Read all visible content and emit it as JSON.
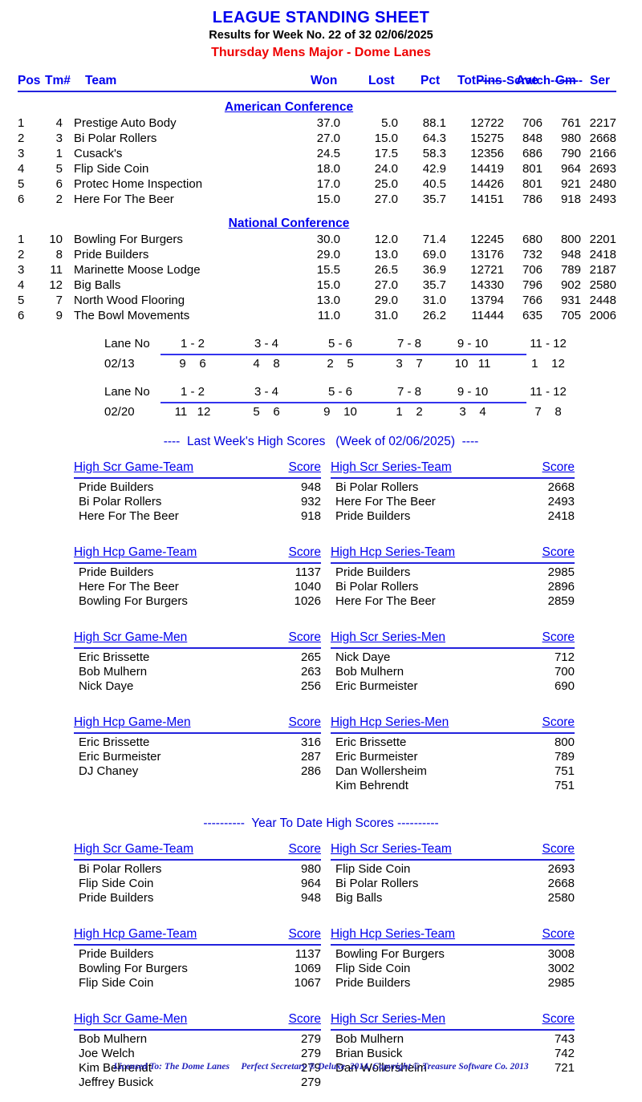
{
  "header": {
    "title": "LEAGUE STANDING SHEET",
    "subtitle": "Results for Week No. 22 of 32    02/06/2025",
    "league": "Thursday Mens Major - Dome Lanes",
    "title_color": "#0000ee",
    "league_color": "#ee0000"
  },
  "standings": {
    "scratch_group_label": "-------Scratch--------",
    "columns": {
      "pos": "Pos",
      "tm": "Tm#",
      "team": "Team",
      "won": "Won",
      "lost": "Lost",
      "pct": "Pct",
      "totpins": "TotPins",
      "ave": "Ave",
      "gm": "Gm",
      "ser": "Ser"
    },
    "conferences": [
      {
        "name": "American Conference",
        "rows": [
          {
            "pos": "1",
            "tm": "4",
            "team": "Prestige Auto Body",
            "won": "37.0",
            "lost": "5.0",
            "pct": "88.1",
            "totpins": "12722",
            "ave": "706",
            "gm": "761",
            "ser": "2217"
          },
          {
            "pos": "2",
            "tm": "3",
            "team": "Bi Polar Rollers",
            "won": "27.0",
            "lost": "15.0",
            "pct": "64.3",
            "totpins": "15275",
            "ave": "848",
            "gm": "980",
            "ser": "2668"
          },
          {
            "pos": "3",
            "tm": "1",
            "team": "Cusack's",
            "won": "24.5",
            "lost": "17.5",
            "pct": "58.3",
            "totpins": "12356",
            "ave": "686",
            "gm": "790",
            "ser": "2166"
          },
          {
            "pos": "4",
            "tm": "5",
            "team": "Flip Side Coin",
            "won": "18.0",
            "lost": "24.0",
            "pct": "42.9",
            "totpins": "14419",
            "ave": "801",
            "gm": "964",
            "ser": "2693"
          },
          {
            "pos": "5",
            "tm": "6",
            "team": "Protec Home Inspection",
            "won": "17.0",
            "lost": "25.0",
            "pct": "40.5",
            "totpins": "14426",
            "ave": "801",
            "gm": "921",
            "ser": "2480"
          },
          {
            "pos": "6",
            "tm": "2",
            "team": "Here For The Beer",
            "won": "15.0",
            "lost": "27.0",
            "pct": "35.7",
            "totpins": "14151",
            "ave": "786",
            "gm": "918",
            "ser": "2493"
          }
        ]
      },
      {
        "name": "National Conference",
        "rows": [
          {
            "pos": "1",
            "tm": "10",
            "team": "Bowling For Burgers",
            "won": "30.0",
            "lost": "12.0",
            "pct": "71.4",
            "totpins": "12245",
            "ave": "680",
            "gm": "800",
            "ser": "2201"
          },
          {
            "pos": "2",
            "tm": "8",
            "team": "Pride Builders",
            "won": "29.0",
            "lost": "13.0",
            "pct": "69.0",
            "totpins": "13176",
            "ave": "732",
            "gm": "948",
            "ser": "2418"
          },
          {
            "pos": "3",
            "tm": "11",
            "team": "Marinette Moose Lodge",
            "won": "15.5",
            "lost": "26.5",
            "pct": "36.9",
            "totpins": "12721",
            "ave": "706",
            "gm": "789",
            "ser": "2187"
          },
          {
            "pos": "4",
            "tm": "12",
            "team": "Big Balls",
            "won": "15.0",
            "lost": "27.0",
            "pct": "35.7",
            "totpins": "14330",
            "ave": "796",
            "gm": "902",
            "ser": "2580"
          },
          {
            "pos": "5",
            "tm": "7",
            "team": "North Wood Flooring",
            "won": "13.0",
            "lost": "29.0",
            "pct": "31.0",
            "totpins": "13794",
            "ave": "766",
            "gm": "931",
            "ser": "2448"
          },
          {
            "pos": "6",
            "tm": "9",
            "team": "The Bowl Movements",
            "won": "11.0",
            "lost": "31.0",
            "pct": "26.2",
            "totpins": "11444",
            "ave": "635",
            "gm": "705",
            "ser": "2006"
          }
        ]
      }
    ]
  },
  "lane_schedules": [
    {
      "label": "Lane No",
      "date": "02/13",
      "lane_pairs": [
        "1 - 2",
        "3 - 4",
        "5 - 6",
        "7 - 8",
        "9 - 10",
        "11 - 12"
      ],
      "matchups": [
        "9    6",
        "4    8",
        "2    5",
        "3    7",
        "10   11",
        "1    12"
      ]
    },
    {
      "label": "Lane No",
      "date": "02/20",
      "lane_pairs": [
        "1 - 2",
        "3 - 4",
        "5 - 6",
        "7 - 8",
        "9 - 10",
        "11 - 12"
      ],
      "matchups": [
        "11   12",
        "5    6",
        "9    10",
        "1    2",
        "3    4",
        "7    8"
      ]
    }
  ],
  "last_week": {
    "section_title": "----  Last Week's High Scores   (Week of 02/06/2025)  ----",
    "score_header": "Score",
    "groups": [
      {
        "left": {
          "title": "High Scr Game-Team",
          "rows": [
            {
              "name": "Pride Builders",
              "score": "948"
            },
            {
              "name": "Bi Polar Rollers",
              "score": "932"
            },
            {
              "name": "Here For The Beer",
              "score": "918"
            }
          ]
        },
        "right": {
          "title": "High Scr Series-Team",
          "rows": [
            {
              "name": "Bi Polar Rollers",
              "score": "2668"
            },
            {
              "name": "Here For The Beer",
              "score": "2493"
            },
            {
              "name": "Pride Builders",
              "score": "2418"
            }
          ]
        }
      },
      {
        "left": {
          "title": "High Hcp Game-Team",
          "rows": [
            {
              "name": "Pride Builders",
              "score": "1137"
            },
            {
              "name": "Here For The Beer",
              "score": "1040"
            },
            {
              "name": "Bowling For Burgers",
              "score": "1026"
            }
          ]
        },
        "right": {
          "title": "High Hcp Series-Team",
          "rows": [
            {
              "name": "Pride Builders",
              "score": "2985"
            },
            {
              "name": "Bi Polar Rollers",
              "score": "2896"
            },
            {
              "name": "Here For The Beer",
              "score": "2859"
            }
          ]
        }
      },
      {
        "left": {
          "title": "High Scr Game-Men",
          "rows": [
            {
              "name": "Eric Brissette",
              "score": "265"
            },
            {
              "name": "Bob Mulhern",
              "score": "263"
            },
            {
              "name": "Nick Daye",
              "score": "256"
            }
          ]
        },
        "right": {
          "title": "High Scr Series-Men",
          "rows": [
            {
              "name": "Nick Daye",
              "score": "712"
            },
            {
              "name": "Bob Mulhern",
              "score": "700"
            },
            {
              "name": "Eric Burmeister",
              "score": "690"
            }
          ]
        }
      },
      {
        "left": {
          "title": "High Hcp Game-Men",
          "rows": [
            {
              "name": "Eric Brissette",
              "score": "316"
            },
            {
              "name": "Eric Burmeister",
              "score": "287"
            },
            {
              "name": "DJ Chaney",
              "score": "286"
            }
          ]
        },
        "right": {
          "title": "High Hcp Series-Men",
          "rows": [
            {
              "name": "Eric Brissette",
              "score": "800"
            },
            {
              "name": "Eric Burmeister",
              "score": "789"
            },
            {
              "name": "Dan Wollersheim",
              "score": "751"
            },
            {
              "name": "Kim Behrendt",
              "score": "751"
            }
          ]
        }
      }
    ]
  },
  "year_to_date": {
    "section_title": "----------  Year To Date High Scores ----------",
    "score_header": "Score",
    "groups": [
      {
        "left": {
          "title": "High Scr Game-Team",
          "rows": [
            {
              "name": "Bi Polar Rollers",
              "score": "980"
            },
            {
              "name": "Flip Side Coin",
              "score": "964"
            },
            {
              "name": "Pride Builders",
              "score": "948"
            }
          ]
        },
        "right": {
          "title": "High Scr Series-Team",
          "rows": [
            {
              "name": "Flip Side Coin",
              "score": "2693"
            },
            {
              "name": "Bi Polar Rollers",
              "score": "2668"
            },
            {
              "name": "Big Balls",
              "score": "2580"
            }
          ]
        }
      },
      {
        "left": {
          "title": "High Hcp Game-Team",
          "rows": [
            {
              "name": "Pride Builders",
              "score": "1137"
            },
            {
              "name": "Bowling For Burgers",
              "score": "1069"
            },
            {
              "name": "Flip Side Coin",
              "score": "1067"
            }
          ]
        },
        "right": {
          "title": "High Hcp Series-Team",
          "rows": [
            {
              "name": "Bowling For Burgers",
              "score": "3008"
            },
            {
              "name": "Flip Side Coin",
              "score": "3002"
            },
            {
              "name": "Pride Builders",
              "score": "2985"
            }
          ]
        }
      },
      {
        "left": {
          "title": "High Scr Game-Men",
          "rows": [
            {
              "name": "Bob Mulhern",
              "score": "279"
            },
            {
              "name": "Joe Welch",
              "score": "279"
            },
            {
              "name": "Kim Behrendt",
              "score": "279"
            },
            {
              "name": "Jeffrey Busick",
              "score": "279"
            }
          ]
        },
        "right": {
          "title": "High Scr Series-Men",
          "rows": [
            {
              "name": "Bob Mulhern",
              "score": "743"
            },
            {
              "name": "Brian Busick",
              "score": "742"
            },
            {
              "name": "Dan Wollersheim",
              "score": "721"
            }
          ]
        }
      }
    ]
  },
  "footer": {
    "text": "Licensed To: The Dome Lanes     Perfect Secretary ® Deluxe  2014, Copyright © Treasure Software Co. 2013"
  }
}
